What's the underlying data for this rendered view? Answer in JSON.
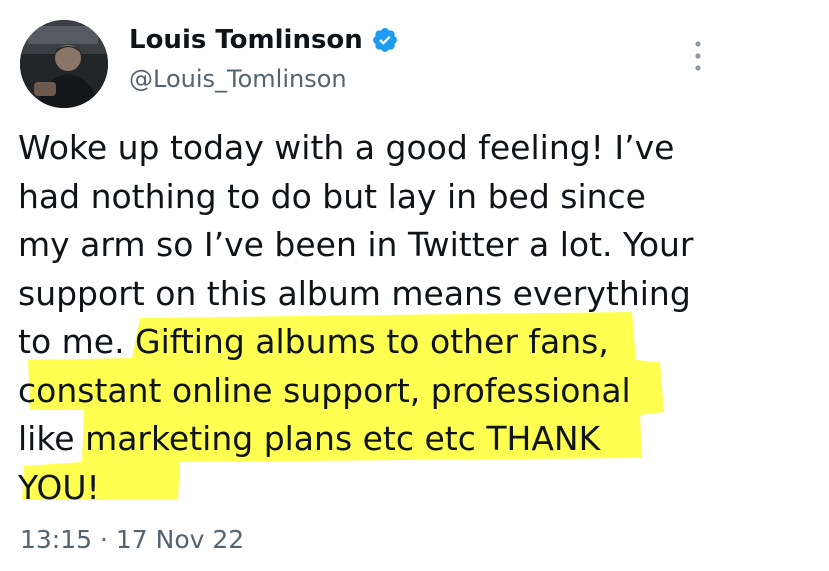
{
  "tweet": {
    "author": {
      "display_name": "Louis Tomlinson",
      "handle": "@Louis_Tomlinson",
      "verified": true,
      "verified_color": "#1d9bf0"
    },
    "text_lines": [
      "Woke up today with a good feeling! I’ve",
      "had nothing to do but lay in bed since",
      "my arm so I’ve been in Twitter a lot. Your",
      "support on this album means everything",
      "to me. Gifting albums to other fans,",
      "constant online support, professional",
      "like marketing plans etc etc THANK",
      "YOU!"
    ],
    "highlight_color": "#ffff33",
    "time": "13:15",
    "separator": "·",
    "date": "17 Nov 22"
  },
  "icons": {
    "verified": "verified-badge-icon",
    "more": "more-options-icon"
  }
}
